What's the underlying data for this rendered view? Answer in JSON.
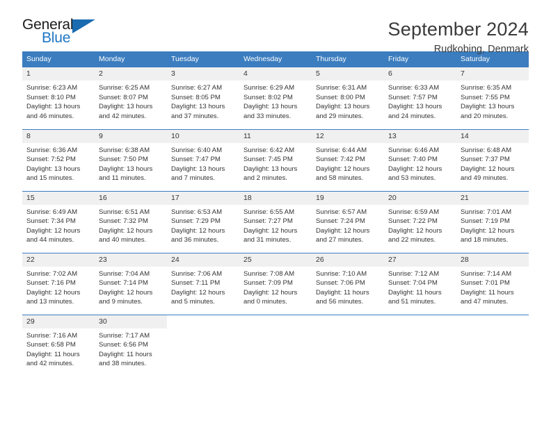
{
  "brand": {
    "name_part1": "General",
    "name_part2": "Blue"
  },
  "header": {
    "title": "September 2024",
    "location": "Rudkobing, Denmark"
  },
  "theme": {
    "header_blue": "#3b7dbf",
    "logo_blue": "#1f76c4",
    "daynum_gray": "#f0f0f0",
    "text": "#333333"
  },
  "weekdays": [
    "Sunday",
    "Monday",
    "Tuesday",
    "Wednesday",
    "Thursday",
    "Friday",
    "Saturday"
  ],
  "weeks": [
    [
      {
        "day": "1",
        "sunrise": "Sunrise: 6:23 AM",
        "sunset": "Sunset: 8:10 PM",
        "daylight_line1": "Daylight: 13 hours",
        "daylight_line2": "and 46 minutes."
      },
      {
        "day": "2",
        "sunrise": "Sunrise: 6:25 AM",
        "sunset": "Sunset: 8:07 PM",
        "daylight_line1": "Daylight: 13 hours",
        "daylight_line2": "and 42 minutes."
      },
      {
        "day": "3",
        "sunrise": "Sunrise: 6:27 AM",
        "sunset": "Sunset: 8:05 PM",
        "daylight_line1": "Daylight: 13 hours",
        "daylight_line2": "and 37 minutes."
      },
      {
        "day": "4",
        "sunrise": "Sunrise: 6:29 AM",
        "sunset": "Sunset: 8:02 PM",
        "daylight_line1": "Daylight: 13 hours",
        "daylight_line2": "and 33 minutes."
      },
      {
        "day": "5",
        "sunrise": "Sunrise: 6:31 AM",
        "sunset": "Sunset: 8:00 PM",
        "daylight_line1": "Daylight: 13 hours",
        "daylight_line2": "and 29 minutes."
      },
      {
        "day": "6",
        "sunrise": "Sunrise: 6:33 AM",
        "sunset": "Sunset: 7:57 PM",
        "daylight_line1": "Daylight: 13 hours",
        "daylight_line2": "and 24 minutes."
      },
      {
        "day": "7",
        "sunrise": "Sunrise: 6:35 AM",
        "sunset": "Sunset: 7:55 PM",
        "daylight_line1": "Daylight: 13 hours",
        "daylight_line2": "and 20 minutes."
      }
    ],
    [
      {
        "day": "8",
        "sunrise": "Sunrise: 6:36 AM",
        "sunset": "Sunset: 7:52 PM",
        "daylight_line1": "Daylight: 13 hours",
        "daylight_line2": "and 15 minutes."
      },
      {
        "day": "9",
        "sunrise": "Sunrise: 6:38 AM",
        "sunset": "Sunset: 7:50 PM",
        "daylight_line1": "Daylight: 13 hours",
        "daylight_line2": "and 11 minutes."
      },
      {
        "day": "10",
        "sunrise": "Sunrise: 6:40 AM",
        "sunset": "Sunset: 7:47 PM",
        "daylight_line1": "Daylight: 13 hours",
        "daylight_line2": "and 7 minutes."
      },
      {
        "day": "11",
        "sunrise": "Sunrise: 6:42 AM",
        "sunset": "Sunset: 7:45 PM",
        "daylight_line1": "Daylight: 13 hours",
        "daylight_line2": "and 2 minutes."
      },
      {
        "day": "12",
        "sunrise": "Sunrise: 6:44 AM",
        "sunset": "Sunset: 7:42 PM",
        "daylight_line1": "Daylight: 12 hours",
        "daylight_line2": "and 58 minutes."
      },
      {
        "day": "13",
        "sunrise": "Sunrise: 6:46 AM",
        "sunset": "Sunset: 7:40 PM",
        "daylight_line1": "Daylight: 12 hours",
        "daylight_line2": "and 53 minutes."
      },
      {
        "day": "14",
        "sunrise": "Sunrise: 6:48 AM",
        "sunset": "Sunset: 7:37 PM",
        "daylight_line1": "Daylight: 12 hours",
        "daylight_line2": "and 49 minutes."
      }
    ],
    [
      {
        "day": "15",
        "sunrise": "Sunrise: 6:49 AM",
        "sunset": "Sunset: 7:34 PM",
        "daylight_line1": "Daylight: 12 hours",
        "daylight_line2": "and 44 minutes."
      },
      {
        "day": "16",
        "sunrise": "Sunrise: 6:51 AM",
        "sunset": "Sunset: 7:32 PM",
        "daylight_line1": "Daylight: 12 hours",
        "daylight_line2": "and 40 minutes."
      },
      {
        "day": "17",
        "sunrise": "Sunrise: 6:53 AM",
        "sunset": "Sunset: 7:29 PM",
        "daylight_line1": "Daylight: 12 hours",
        "daylight_line2": "and 36 minutes."
      },
      {
        "day": "18",
        "sunrise": "Sunrise: 6:55 AM",
        "sunset": "Sunset: 7:27 PM",
        "daylight_line1": "Daylight: 12 hours",
        "daylight_line2": "and 31 minutes."
      },
      {
        "day": "19",
        "sunrise": "Sunrise: 6:57 AM",
        "sunset": "Sunset: 7:24 PM",
        "daylight_line1": "Daylight: 12 hours",
        "daylight_line2": "and 27 minutes."
      },
      {
        "day": "20",
        "sunrise": "Sunrise: 6:59 AM",
        "sunset": "Sunset: 7:22 PM",
        "daylight_line1": "Daylight: 12 hours",
        "daylight_line2": "and 22 minutes."
      },
      {
        "day": "21",
        "sunrise": "Sunrise: 7:01 AM",
        "sunset": "Sunset: 7:19 PM",
        "daylight_line1": "Daylight: 12 hours",
        "daylight_line2": "and 18 minutes."
      }
    ],
    [
      {
        "day": "22",
        "sunrise": "Sunrise: 7:02 AM",
        "sunset": "Sunset: 7:16 PM",
        "daylight_line1": "Daylight: 12 hours",
        "daylight_line2": "and 13 minutes."
      },
      {
        "day": "23",
        "sunrise": "Sunrise: 7:04 AM",
        "sunset": "Sunset: 7:14 PM",
        "daylight_line1": "Daylight: 12 hours",
        "daylight_line2": "and 9 minutes."
      },
      {
        "day": "24",
        "sunrise": "Sunrise: 7:06 AM",
        "sunset": "Sunset: 7:11 PM",
        "daylight_line1": "Daylight: 12 hours",
        "daylight_line2": "and 5 minutes."
      },
      {
        "day": "25",
        "sunrise": "Sunrise: 7:08 AM",
        "sunset": "Sunset: 7:09 PM",
        "daylight_line1": "Daylight: 12 hours",
        "daylight_line2": "and 0 minutes."
      },
      {
        "day": "26",
        "sunrise": "Sunrise: 7:10 AM",
        "sunset": "Sunset: 7:06 PM",
        "daylight_line1": "Daylight: 11 hours",
        "daylight_line2": "and 56 minutes."
      },
      {
        "day": "27",
        "sunrise": "Sunrise: 7:12 AM",
        "sunset": "Sunset: 7:04 PM",
        "daylight_line1": "Daylight: 11 hours",
        "daylight_line2": "and 51 minutes."
      },
      {
        "day": "28",
        "sunrise": "Sunrise: 7:14 AM",
        "sunset": "Sunset: 7:01 PM",
        "daylight_line1": "Daylight: 11 hours",
        "daylight_line2": "and 47 minutes."
      }
    ],
    [
      {
        "day": "29",
        "sunrise": "Sunrise: 7:16 AM",
        "sunset": "Sunset: 6:58 PM",
        "daylight_line1": "Daylight: 11 hours",
        "daylight_line2": "and 42 minutes."
      },
      {
        "day": "30",
        "sunrise": "Sunrise: 7:17 AM",
        "sunset": "Sunset: 6:56 PM",
        "daylight_line1": "Daylight: 11 hours",
        "daylight_line2": "and 38 minutes."
      },
      {
        "day": "",
        "sunrise": "",
        "sunset": "",
        "daylight_line1": "",
        "daylight_line2": ""
      },
      {
        "day": "",
        "sunrise": "",
        "sunset": "",
        "daylight_line1": "",
        "daylight_line2": ""
      },
      {
        "day": "",
        "sunrise": "",
        "sunset": "",
        "daylight_line1": "",
        "daylight_line2": ""
      },
      {
        "day": "",
        "sunrise": "",
        "sunset": "",
        "daylight_line1": "",
        "daylight_line2": ""
      },
      {
        "day": "",
        "sunrise": "",
        "sunset": "",
        "daylight_line1": "",
        "daylight_line2": ""
      }
    ]
  ]
}
